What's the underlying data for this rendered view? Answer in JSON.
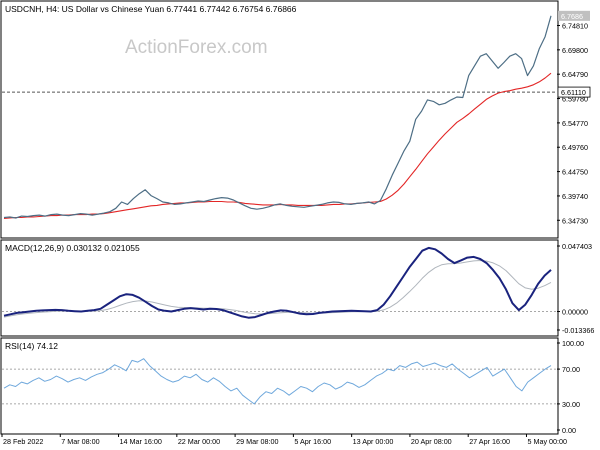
{
  "header": {
    "symbol_line": "USDCNH, H4:  US Dollar vs Chinese Yuan  6.77441 6.77442 6.76754 6.76866",
    "watermark": "ActionForex.com"
  },
  "colors": {
    "price": "#4d6e85",
    "ma": "#e32626",
    "macd_main": "#1a237e",
    "macd_signal": "#b0b6bd",
    "rsi": "#6fa8dc",
    "grid_dash": "#8c8c8c",
    "border": "#000000"
  },
  "chart_data": [
    {
      "type": "line",
      "name": "price",
      "title": "USDCNH, H4:  US Dollar vs Chinese Yuan  6.77441 6.77442 6.76754 6.76866",
      "ylim": [
        6.3273,
        6.7841
      ],
      "y_ticks": [
        "6.74810",
        "6.69800",
        "6.64790",
        "6.59780",
        "6.54770",
        "6.49760",
        "6.44750",
        "6.39740",
        "6.34730"
      ],
      "current_price_label": "6.7686",
      "horizontal_line_label": "6.61110",
      "horizontal_line_value": 6.6111,
      "series": [
        {
          "name": "USDCNH",
          "values": [
            6.353,
            6.354,
            6.352,
            6.356,
            6.355,
            6.357,
            6.358,
            6.356,
            6.359,
            6.36,
            6.358,
            6.357,
            6.359,
            6.361,
            6.36,
            6.358,
            6.36,
            6.362,
            6.365,
            6.372,
            6.385,
            6.38,
            6.392,
            6.402,
            6.41,
            6.398,
            6.392,
            6.385,
            6.383,
            6.38,
            6.381,
            6.383,
            6.385,
            6.387,
            6.386,
            6.389,
            6.392,
            6.394,
            6.393,
            6.389,
            6.383,
            6.377,
            6.372,
            6.37,
            6.372,
            6.375,
            6.379,
            6.381,
            6.378,
            6.376,
            6.375,
            6.374,
            6.376,
            6.378,
            6.38,
            6.383,
            6.385,
            6.384,
            6.381,
            6.38,
            6.382,
            6.383,
            6.385,
            6.381,
            6.388,
            6.412,
            6.44,
            6.465,
            6.49,
            6.51,
            6.555,
            6.572,
            6.595,
            6.592,
            6.585,
            6.588,
            6.595,
            6.601,
            6.6,
            6.645,
            6.665,
            6.685,
            6.69,
            6.675,
            6.66,
            6.672,
            6.685,
            6.69,
            6.68,
            6.645,
            6.665,
            6.7,
            6.725,
            6.768
          ]
        },
        {
          "name": "MA",
          "values": [
            6.351,
            6.352,
            6.353,
            6.353,
            6.354,
            6.354,
            6.355,
            6.356,
            6.357,
            6.357,
            6.358,
            6.358,
            6.359,
            6.359,
            6.359,
            6.36,
            6.36,
            6.361,
            6.363,
            6.365,
            6.367,
            6.369,
            6.371,
            6.373,
            6.375,
            6.377,
            6.378,
            6.38,
            6.381,
            6.382,
            6.383,
            6.383,
            6.384,
            6.385,
            6.385,
            6.386,
            6.386,
            6.386,
            6.385,
            6.385,
            6.384,
            6.382,
            6.381,
            6.38,
            6.379,
            6.379,
            6.379,
            6.38,
            6.379,
            6.379,
            6.378,
            6.378,
            6.378,
            6.378,
            6.378,
            6.379,
            6.38,
            6.38,
            6.381,
            6.381,
            6.382,
            6.383,
            6.384,
            6.385,
            6.386,
            6.391,
            6.399,
            6.409,
            6.422,
            6.437,
            6.452,
            6.468,
            6.484,
            6.498,
            6.512,
            6.525,
            6.537,
            6.549,
            6.557,
            6.566,
            6.576,
            6.586,
            6.596,
            6.603,
            6.609,
            6.612,
            6.614,
            6.617,
            6.619,
            6.622,
            6.626,
            6.632,
            6.64,
            6.65
          ]
        }
      ]
    },
    {
      "type": "line",
      "name": "MACD",
      "title": "MACD(12,26,9) 0.030132 0.021055",
      "ylim": [
        -0.013366,
        0.047403
      ],
      "y_ticks": [
        "0.047403",
        "0.00000",
        "-0.013366"
      ],
      "series": [
        {
          "name": "MACD",
          "values": [
            -0.003,
            -0.002,
            -0.001,
            -0.0005,
            0.0,
            0.0005,
            0.0008,
            0.001,
            0.0012,
            0.001,
            0.0005,
            0.0002,
            0.0,
            0.0005,
            0.001,
            0.002,
            0.005,
            0.008,
            0.011,
            0.0125,
            0.012,
            0.01,
            0.007,
            0.004,
            0.0015,
            0.0005,
            0.0,
            0.001,
            0.002,
            0.0025,
            0.002,
            0.0015,
            0.002,
            0.0018,
            0.001,
            -0.0005,
            -0.002,
            -0.0035,
            -0.0045,
            -0.004,
            -0.0025,
            -0.001,
            0.0,
            0.0008,
            0.0005,
            -0.0005,
            -0.0015,
            -0.002,
            -0.0018,
            -0.001,
            -0.0005,
            0.0,
            0.0002,
            0.0004,
            0.0006,
            0.0004,
            0.0002,
            0.0,
            0.001,
            0.005,
            0.011,
            0.018,
            0.025,
            0.032,
            0.038,
            0.044,
            0.046,
            0.045,
            0.042,
            0.038,
            0.035,
            0.037,
            0.039,
            0.0395,
            0.038,
            0.035,
            0.03,
            0.024,
            0.016,
            0.006,
            0.001,
            0.005,
            0.012,
            0.02,
            0.026,
            0.0301
          ]
        },
        {
          "name": "Signal",
          "values": [
            -0.004,
            -0.0032,
            -0.0024,
            -0.0017,
            -0.0012,
            -0.0008,
            -0.0004,
            -0.0001,
            0.0002,
            0.0004,
            0.0004,
            0.0004,
            0.0003,
            0.0003,
            0.0004,
            0.0007,
            0.0015,
            0.0028,
            0.0044,
            0.006,
            0.0072,
            0.0078,
            0.0076,
            0.0069,
            0.0058,
            0.0047,
            0.0037,
            0.0031,
            0.0029,
            0.0028,
            0.0026,
            0.0024,
            0.0023,
            0.0022,
            0.002,
            0.0015,
            0.0008,
            -0.0001,
            -0.001,
            -0.0016,
            -0.0018,
            -0.0016,
            -0.0013,
            -0.0009,
            -0.0006,
            -0.0006,
            -0.0008,
            -0.001,
            -0.0012,
            -0.0011,
            -0.001,
            -0.0008,
            -0.0006,
            -0.0004,
            -0.0002,
            -0.0001,
            0.0,
            0.0,
            0.0002,
            0.0012,
            0.0031,
            0.0061,
            0.0099,
            0.0143,
            0.019,
            0.024,
            0.0284,
            0.0317,
            0.0338,
            0.0346,
            0.0347,
            0.0351,
            0.0359,
            0.0366,
            0.0369,
            0.0365,
            0.0352,
            0.033,
            0.0296,
            0.0249,
            0.0201,
            0.0171,
            0.0161,
            0.0169,
            0.0187,
            0.0211
          ]
        }
      ]
    },
    {
      "type": "line",
      "name": "RSI",
      "title": "RSI(14) 74.12",
      "ylim": [
        0,
        100
      ],
      "y_ticks": [
        "100.00",
        "70.00",
        "30.00",
        "0.00"
      ],
      "dashed_levels": [
        70,
        30
      ],
      "series": [
        {
          "name": "RSI",
          "values": [
            48,
            52,
            50,
            55,
            53,
            57,
            60,
            56,
            58,
            62,
            59,
            55,
            58,
            60,
            57,
            61,
            64,
            66,
            70,
            75,
            72,
            68,
            80,
            78,
            82,
            74,
            68,
            62,
            58,
            55,
            57,
            62,
            60,
            64,
            58,
            55,
            60,
            56,
            50,
            45,
            48,
            40,
            35,
            30,
            38,
            44,
            42,
            48,
            45,
            40,
            45,
            50,
            48,
            44,
            50,
            54,
            52,
            47,
            50,
            55,
            53,
            49,
            52,
            57,
            62,
            65,
            70,
            68,
            74,
            72,
            76,
            78,
            73,
            75,
            77,
            74,
            72,
            76,
            70,
            65,
            60,
            64,
            68,
            72,
            62,
            66,
            70,
            60,
            50,
            45,
            55,
            60,
            65,
            70,
            74
          ]
        }
      ]
    },
    {
      "type": "axis",
      "name": "time-axis",
      "x_tick_labels": [
        "28 Feb 2022",
        "7 Mar 08:00",
        "14 Mar 16:00",
        "22 Mar 00:00",
        "29 Mar 08:00",
        "5 Apr 16:00",
        "13 Apr 00:00",
        "20 Apr 08:00",
        "27 Apr 16:00",
        "5 May 00:00"
      ],
      "x_tick_positions": [
        0,
        0.105,
        0.21,
        0.315,
        0.42,
        0.525,
        0.63,
        0.735,
        0.84,
        0.945
      ]
    }
  ]
}
